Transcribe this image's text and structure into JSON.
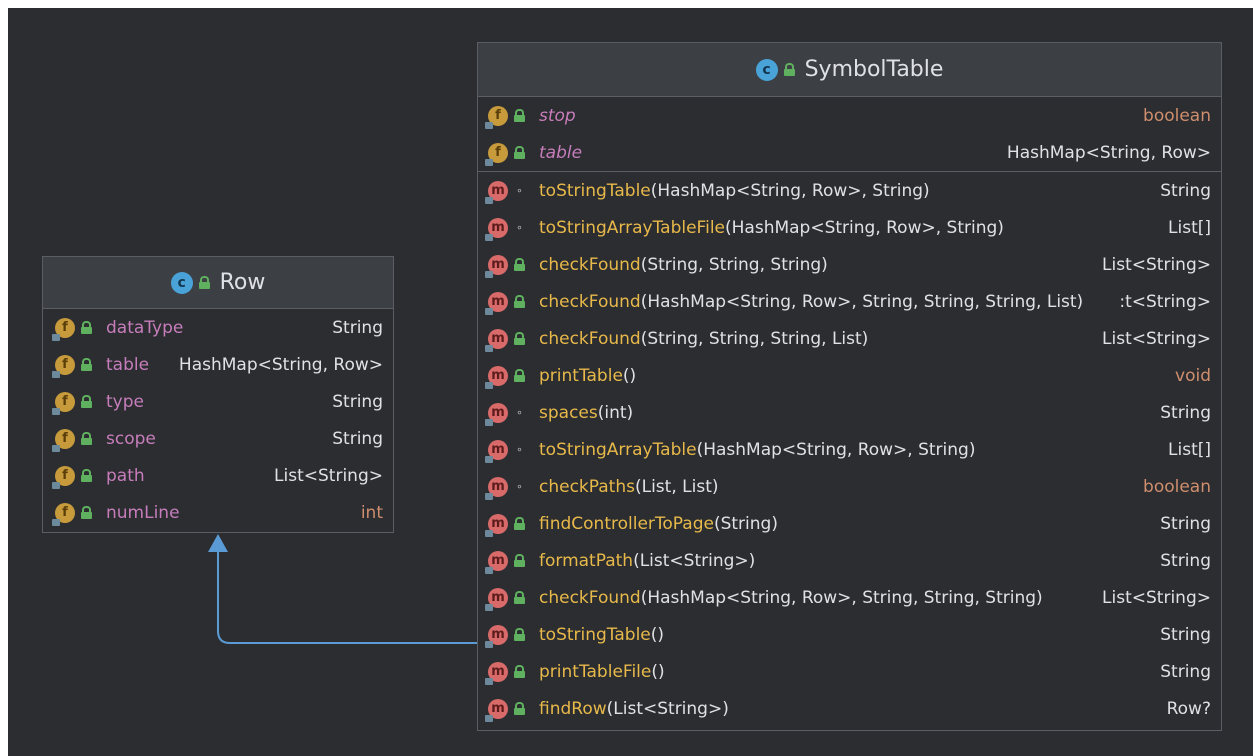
{
  "row_class": {
    "title": "Row",
    "fields": [
      {
        "name": "dataType",
        "type": "String",
        "type_keyword": false
      },
      {
        "name": "table",
        "type": "HashMap<String, Row>",
        "type_keyword": false
      },
      {
        "name": "type",
        "type": "String",
        "type_keyword": false
      },
      {
        "name": "scope",
        "type": "String",
        "type_keyword": false
      },
      {
        "name": "path",
        "type": "List<String>",
        "type_keyword": false
      },
      {
        "name": "numLine",
        "type": "int",
        "type_keyword": true
      }
    ]
  },
  "symbol_table_class": {
    "title": "SymbolTable",
    "fields": [
      {
        "name": "stop",
        "type": "boolean",
        "type_keyword": true
      },
      {
        "name": "table",
        "type": "HashMap<String, Row>",
        "type_keyword": false
      }
    ],
    "methods": [
      {
        "visibility": "package",
        "name": "toStringTable",
        "params": "(HashMap<String, Row>, String)",
        "returns": "String",
        "return_keyword": false
      },
      {
        "visibility": "package",
        "name": "toStringArrayTableFile",
        "params": "(HashMap<String, Row>, String)",
        "returns": "List[]",
        "return_keyword": false
      },
      {
        "visibility": "public",
        "name": "checkFound",
        "params": "(String, String, String)",
        "returns": "List<String>",
        "return_keyword": false
      },
      {
        "visibility": "public",
        "name": "checkFound",
        "params": "(HashMap<String, Row>, String, String, String, List)",
        "returns": ":t<String>",
        "return_keyword": false
      },
      {
        "visibility": "public",
        "name": "checkFound",
        "params": "(String, String, String, List)",
        "returns": "List<String>",
        "return_keyword": false
      },
      {
        "visibility": "public",
        "name": "printTable",
        "params": "()",
        "returns": "void",
        "return_keyword": true
      },
      {
        "visibility": "package",
        "name": "spaces",
        "params": "(int)",
        "returns": "String",
        "return_keyword": false
      },
      {
        "visibility": "package",
        "name": "toStringArrayTable",
        "params": "(HashMap<String, Row>, String)",
        "returns": "List[]",
        "return_keyword": false
      },
      {
        "visibility": "package",
        "name": "checkPaths",
        "params": "(List, List)",
        "returns": "boolean",
        "return_keyword": true
      },
      {
        "visibility": "public",
        "name": "findControllerToPage",
        "params": "(String)",
        "returns": "String",
        "return_keyword": false
      },
      {
        "visibility": "public",
        "name": "formatPath",
        "params": "(List<String>)",
        "returns": "String",
        "return_keyword": false
      },
      {
        "visibility": "public",
        "name": "checkFound",
        "params": "(HashMap<String, Row>, String, String, String)",
        "returns": "List<String>",
        "return_keyword": false
      },
      {
        "visibility": "public",
        "name": "toStringTable",
        "params": "()",
        "returns": "String",
        "return_keyword": false
      },
      {
        "visibility": "public",
        "name": "printTableFile",
        "params": "()",
        "returns": "String",
        "return_keyword": false
      },
      {
        "visibility": "public",
        "name": "findRow",
        "params": "(List<String>)",
        "returns": "Row?",
        "return_keyword": false
      }
    ]
  },
  "icons": {
    "class_icon": "class-icon",
    "field_icon": "field-icon",
    "method_icon": "method-icon",
    "public_icon": "public-lock-icon",
    "package_icon": "package-dot-icon",
    "class_letter": "c",
    "field_letter": "f",
    "method_letter": "m",
    "package_glyph": "∘"
  },
  "colors": {
    "background": "#2b2d30",
    "arrow": "#5b9bd5",
    "field_name": "#c77dbb",
    "method_name": "#e8b94a",
    "keyword": "#cf8e6d"
  }
}
